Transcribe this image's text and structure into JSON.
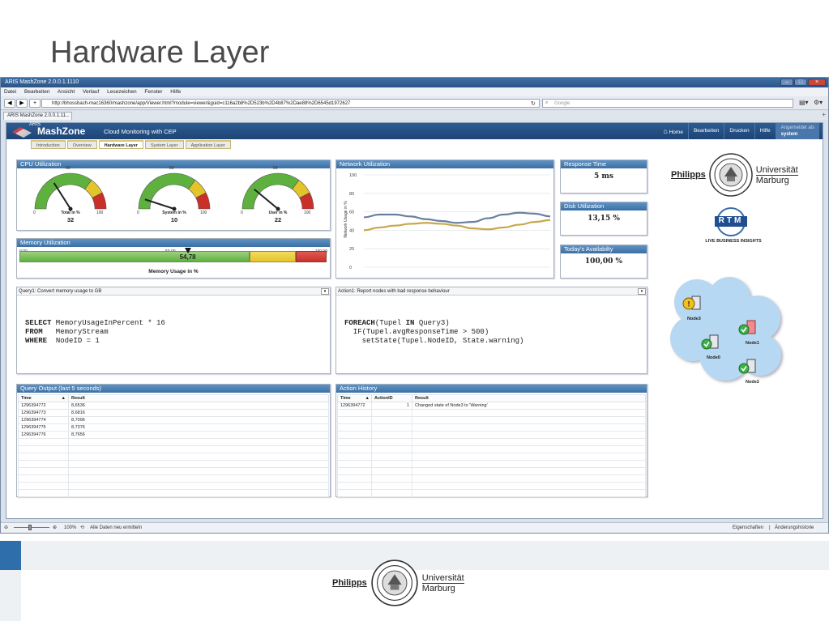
{
  "slide": {
    "title": "Hardware Layer"
  },
  "browser": {
    "window_title": "ARIS MashZone 2.0.0.1.1110",
    "menu": [
      "Datei",
      "Bearbeiten",
      "Ansicht",
      "Verlauf",
      "Lesezeichen",
      "Fenster",
      "Hilfe"
    ],
    "url": "http://bhossbach-mac16360/mashzone/app/Viewer.html?module=viewer&guid=c116a2b8%2D523b%2D4b87%2Dae88%2D6545d1972627",
    "search_placeholder": "Google",
    "tab_label": "ARIS MashZone 2.0.0.1.11..."
  },
  "app": {
    "brand_small": "ARIS",
    "brand": "MashZone",
    "subtitle": "Cloud Monitoring with CEP",
    "nav": {
      "home": "Home",
      "edit": "Bearbeiten",
      "print": "Drucken",
      "help": "Hilfe",
      "login_line1": "Angemeldet als",
      "login_line2": "system"
    },
    "tabs": [
      "Introduction",
      "Overview",
      "Hardware Layer",
      "System Layer",
      "Application Layer"
    ],
    "active_tab": "Hardware Layer"
  },
  "cpu": {
    "title": "CPU Utilization",
    "gauges": [
      {
        "label": "Total in %",
        "value": 32,
        "min": "0",
        "mid": "50",
        "max": "100"
      },
      {
        "label": "System in %",
        "value": 10,
        "min": "0",
        "mid": "50",
        "max": "100"
      },
      {
        "label": "User in %",
        "value": 22,
        "min": "0",
        "mid": "50",
        "max": "100"
      }
    ]
  },
  "memory": {
    "title": "Memory Utilization",
    "min": "0,00",
    "mid": "50,00",
    "max": "100,00",
    "value_text": "54,78",
    "value": 54.78,
    "label": "Memory Usage in %"
  },
  "network": {
    "title": "Network Utilization",
    "ylabel": "Network Usage in %",
    "yticks": [
      "100",
      "80",
      "60",
      "40",
      "20",
      "0"
    ]
  },
  "chart_data": {
    "type": "line",
    "title": "Network Utilization",
    "xlabel": "",
    "ylabel": "Network Usage in %",
    "ylim": [
      0,
      100
    ],
    "grid": true,
    "x": [
      0,
      1,
      2,
      3,
      4,
      5,
      6,
      7,
      8,
      9,
      10,
      11,
      12
    ],
    "series": [
      {
        "color": "#6a7fa0",
        "values": [
          54,
          57,
          57,
          55,
          52,
          50,
          48,
          49,
          53,
          57,
          59,
          58,
          55
        ]
      },
      {
        "color": "#c9a84a",
        "values": [
          40,
          43,
          45,
          47,
          48,
          47,
          45,
          42,
          41,
          43,
          46,
          49,
          51
        ]
      }
    ]
  },
  "kpis": {
    "response_title": "Response Time",
    "response_value": "5 ms",
    "disk_title": "Disk Utilization",
    "disk_value": "13,15 %",
    "avail_title": "Today's Availabilty",
    "avail_value": "100,00 %"
  },
  "query1": {
    "header": "Query1: Convert memory usage to GB",
    "kw1": "SELECT",
    "rest1": " MemoryUsageInPercent * 16",
    "kw2": "FROM",
    "rest2": "   MemoryStream",
    "kw3": "WHERE",
    "rest3": "  NodeID = 1"
  },
  "action1": {
    "header": "Action1: Report nodes with bad response behaviour",
    "kw1": "FOREACH",
    "mid1": "(Tupel ",
    "kw1b": "IN",
    "rest1": " Query3)",
    "line2": "  IF(Tupel.avgResponseTime > 500)",
    "line3": "    setState(Tupel.NodeID, State.warning)"
  },
  "query_output": {
    "title": "Query Output (last 5 seconds)",
    "col_time": "Time",
    "col_result": "Result",
    "rows": [
      {
        "time": "1296394772",
        "result": "8,6536"
      },
      {
        "time": "1296394773",
        "result": "8,6816"
      },
      {
        "time": "1296394774",
        "result": "8,7096"
      },
      {
        "time": "1296394775",
        "result": "8,7376"
      },
      {
        "time": "1296394776",
        "result": "8,7656"
      }
    ]
  },
  "action_history": {
    "title": "Action History",
    "col_time": "Time",
    "col_actionid": "ActionID",
    "col_result": "Result",
    "rows": [
      {
        "time": "1296394772",
        "actionid": "1",
        "result": "Changed state of Node3 to 'Warning'"
      }
    ]
  },
  "nodes": {
    "node3": "Node3",
    "node1": "Node1",
    "node0": "Node0",
    "node2": "Node2"
  },
  "logos": {
    "uni_left": "Philipps",
    "uni_right1": "Universität",
    "uni_right2": "Marburg",
    "rtm_text": "RTM",
    "rtm_tagline": "LIVE BUSINESS INSIGHTS"
  },
  "statusbar": {
    "zoom": "100%",
    "refresh": "Alle Daten neu ermitteln",
    "properties": "Eigenschaften",
    "history": "Änderungshistorie"
  },
  "colors": {
    "header_blue": "#1e4475",
    "panel_header": "#4a7fb5",
    "gauge_green": "#5eb13f",
    "gauge_yellow": "#e3c42a",
    "gauge_red": "#c9302a",
    "cloud": "#b6d8f3"
  }
}
